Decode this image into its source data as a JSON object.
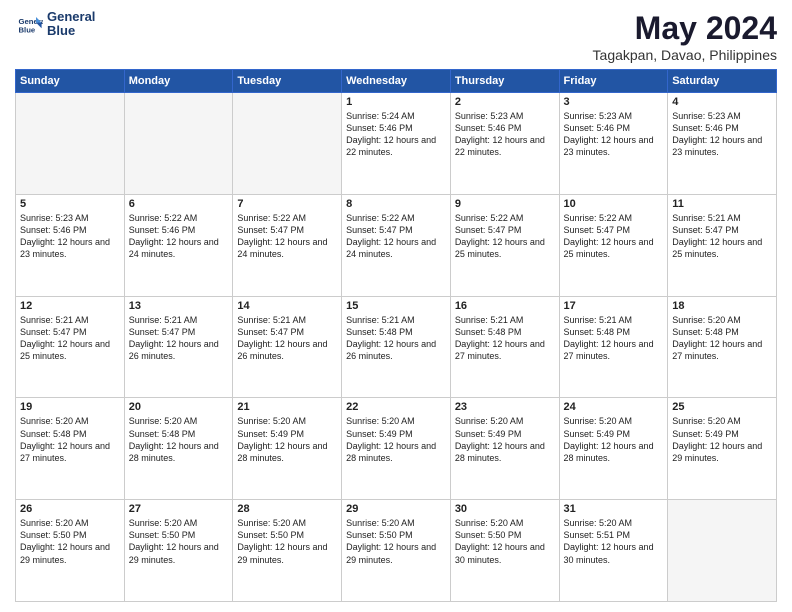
{
  "header": {
    "logo_line1": "General",
    "logo_line2": "Blue",
    "month": "May 2024",
    "location": "Tagakpan, Davao, Philippines"
  },
  "weekdays": [
    "Sunday",
    "Monday",
    "Tuesday",
    "Wednesday",
    "Thursday",
    "Friday",
    "Saturday"
  ],
  "weeks": [
    [
      {
        "day": "",
        "info": ""
      },
      {
        "day": "",
        "info": ""
      },
      {
        "day": "",
        "info": ""
      },
      {
        "day": "1",
        "info": "Sunrise: 5:24 AM\nSunset: 5:46 PM\nDaylight: 12 hours\nand 22 minutes."
      },
      {
        "day": "2",
        "info": "Sunrise: 5:23 AM\nSunset: 5:46 PM\nDaylight: 12 hours\nand 22 minutes."
      },
      {
        "day": "3",
        "info": "Sunrise: 5:23 AM\nSunset: 5:46 PM\nDaylight: 12 hours\nand 23 minutes."
      },
      {
        "day": "4",
        "info": "Sunrise: 5:23 AM\nSunset: 5:46 PM\nDaylight: 12 hours\nand 23 minutes."
      }
    ],
    [
      {
        "day": "5",
        "info": "Sunrise: 5:23 AM\nSunset: 5:46 PM\nDaylight: 12 hours\nand 23 minutes."
      },
      {
        "day": "6",
        "info": "Sunrise: 5:22 AM\nSunset: 5:46 PM\nDaylight: 12 hours\nand 24 minutes."
      },
      {
        "day": "7",
        "info": "Sunrise: 5:22 AM\nSunset: 5:47 PM\nDaylight: 12 hours\nand 24 minutes."
      },
      {
        "day": "8",
        "info": "Sunrise: 5:22 AM\nSunset: 5:47 PM\nDaylight: 12 hours\nand 24 minutes."
      },
      {
        "day": "9",
        "info": "Sunrise: 5:22 AM\nSunset: 5:47 PM\nDaylight: 12 hours\nand 25 minutes."
      },
      {
        "day": "10",
        "info": "Sunrise: 5:22 AM\nSunset: 5:47 PM\nDaylight: 12 hours\nand 25 minutes."
      },
      {
        "day": "11",
        "info": "Sunrise: 5:21 AM\nSunset: 5:47 PM\nDaylight: 12 hours\nand 25 minutes."
      }
    ],
    [
      {
        "day": "12",
        "info": "Sunrise: 5:21 AM\nSunset: 5:47 PM\nDaylight: 12 hours\nand 25 minutes."
      },
      {
        "day": "13",
        "info": "Sunrise: 5:21 AM\nSunset: 5:47 PM\nDaylight: 12 hours\nand 26 minutes."
      },
      {
        "day": "14",
        "info": "Sunrise: 5:21 AM\nSunset: 5:47 PM\nDaylight: 12 hours\nand 26 minutes."
      },
      {
        "day": "15",
        "info": "Sunrise: 5:21 AM\nSunset: 5:48 PM\nDaylight: 12 hours\nand 26 minutes."
      },
      {
        "day": "16",
        "info": "Sunrise: 5:21 AM\nSunset: 5:48 PM\nDaylight: 12 hours\nand 27 minutes."
      },
      {
        "day": "17",
        "info": "Sunrise: 5:21 AM\nSunset: 5:48 PM\nDaylight: 12 hours\nand 27 minutes."
      },
      {
        "day": "18",
        "info": "Sunrise: 5:20 AM\nSunset: 5:48 PM\nDaylight: 12 hours\nand 27 minutes."
      }
    ],
    [
      {
        "day": "19",
        "info": "Sunrise: 5:20 AM\nSunset: 5:48 PM\nDaylight: 12 hours\nand 27 minutes."
      },
      {
        "day": "20",
        "info": "Sunrise: 5:20 AM\nSunset: 5:48 PM\nDaylight: 12 hours\nand 28 minutes."
      },
      {
        "day": "21",
        "info": "Sunrise: 5:20 AM\nSunset: 5:49 PM\nDaylight: 12 hours\nand 28 minutes."
      },
      {
        "day": "22",
        "info": "Sunrise: 5:20 AM\nSunset: 5:49 PM\nDaylight: 12 hours\nand 28 minutes."
      },
      {
        "day": "23",
        "info": "Sunrise: 5:20 AM\nSunset: 5:49 PM\nDaylight: 12 hours\nand 28 minutes."
      },
      {
        "day": "24",
        "info": "Sunrise: 5:20 AM\nSunset: 5:49 PM\nDaylight: 12 hours\nand 28 minutes."
      },
      {
        "day": "25",
        "info": "Sunrise: 5:20 AM\nSunset: 5:49 PM\nDaylight: 12 hours\nand 29 minutes."
      }
    ],
    [
      {
        "day": "26",
        "info": "Sunrise: 5:20 AM\nSunset: 5:50 PM\nDaylight: 12 hours\nand 29 minutes."
      },
      {
        "day": "27",
        "info": "Sunrise: 5:20 AM\nSunset: 5:50 PM\nDaylight: 12 hours\nand 29 minutes."
      },
      {
        "day": "28",
        "info": "Sunrise: 5:20 AM\nSunset: 5:50 PM\nDaylight: 12 hours\nand 29 minutes."
      },
      {
        "day": "29",
        "info": "Sunrise: 5:20 AM\nSunset: 5:50 PM\nDaylight: 12 hours\nand 29 minutes."
      },
      {
        "day": "30",
        "info": "Sunrise: 5:20 AM\nSunset: 5:50 PM\nDaylight: 12 hours\nand 30 minutes."
      },
      {
        "day": "31",
        "info": "Sunrise: 5:20 AM\nSunset: 5:51 PM\nDaylight: 12 hours\nand 30 minutes."
      },
      {
        "day": "",
        "info": ""
      }
    ]
  ]
}
